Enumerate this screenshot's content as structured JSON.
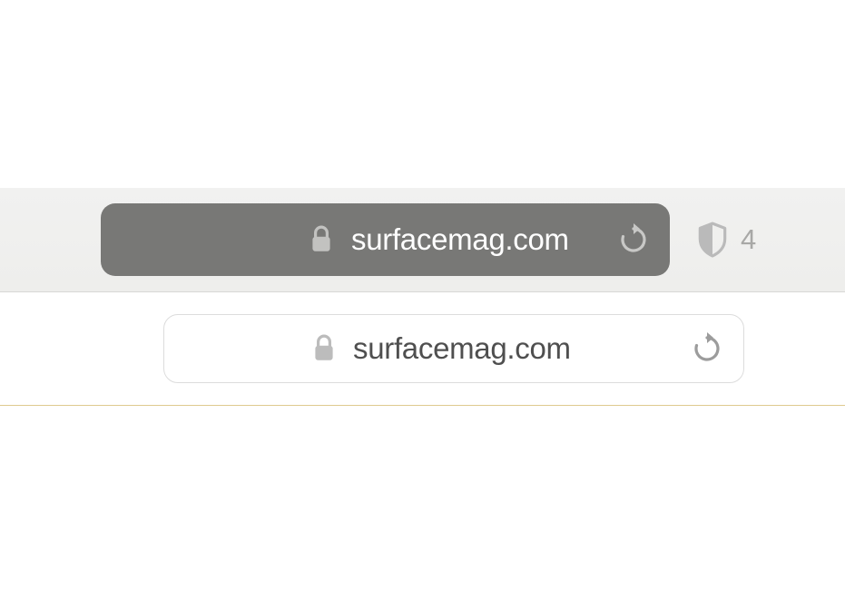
{
  "toolbar": {
    "address_bar": {
      "url": "surfacemag.com"
    },
    "privacy": {
      "tracker_count": "4"
    }
  },
  "page": {
    "address_bar": {
      "url": "surfacemag.com"
    }
  }
}
